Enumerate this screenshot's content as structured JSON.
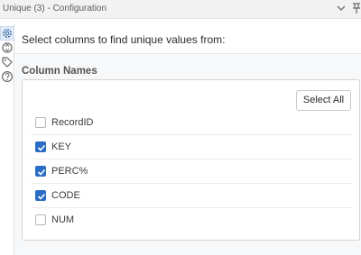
{
  "window": {
    "title": "Unique (3) - Configuration"
  },
  "icons": {
    "collapse": "chevron-down-icon",
    "pin": "pin-icon",
    "sidebar": [
      "gear-icon",
      "refresh-icon",
      "tag-icon",
      "help-icon"
    ]
  },
  "main": {
    "instruction": "Select columns to find unique values from:",
    "section_label": "Column Names",
    "select_all_label": "Select All",
    "columns": [
      {
        "label": "RecordID",
        "checked": false
      },
      {
        "label": "KEY",
        "checked": true
      },
      {
        "label": "PERC%",
        "checked": true
      },
      {
        "label": "CODE",
        "checked": true
      },
      {
        "label": "NUM",
        "checked": false
      }
    ]
  },
  "colors": {
    "accent": "#2b6cc4",
    "panel_border": "#d5d5d5",
    "background": "#f7f8fa"
  }
}
